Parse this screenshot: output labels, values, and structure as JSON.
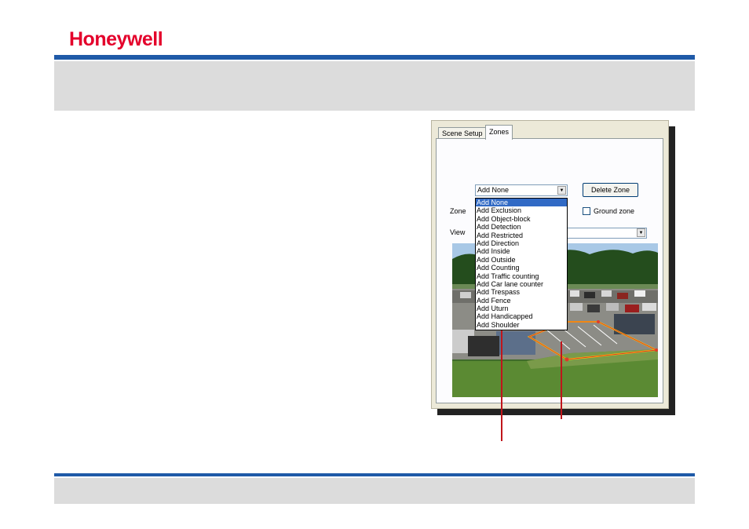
{
  "brand": {
    "logo_text": "Honeywell",
    "logo_color": "#e4002b",
    "accent": "#1f5aa8"
  },
  "dialog": {
    "tabs": [
      {
        "label": "Scene Setup"
      },
      {
        "label": "Zones"
      }
    ],
    "active_tab": "Zones",
    "zone_type_select": {
      "value": "Add None"
    },
    "delete_button": "Delete Zone",
    "zone_label": "Zone",
    "view_label": "View",
    "ground_zone_checkbox": {
      "label": "Ground zone",
      "checked": false
    },
    "dropdown_options": [
      "Add None",
      "Add Exclusion",
      "Add Object-block",
      "Add Detection",
      "Add Restricted",
      "Add Direction",
      "Add Inside",
      "Add Outside",
      "Add Counting",
      "Add Traffic counting",
      "Add Car lane counter",
      "Add Trespass",
      "Add Fence",
      "Add Uturn",
      "Add Handicapped",
      "Add Shoulder"
    ],
    "dropdown_selected": "Add None"
  }
}
